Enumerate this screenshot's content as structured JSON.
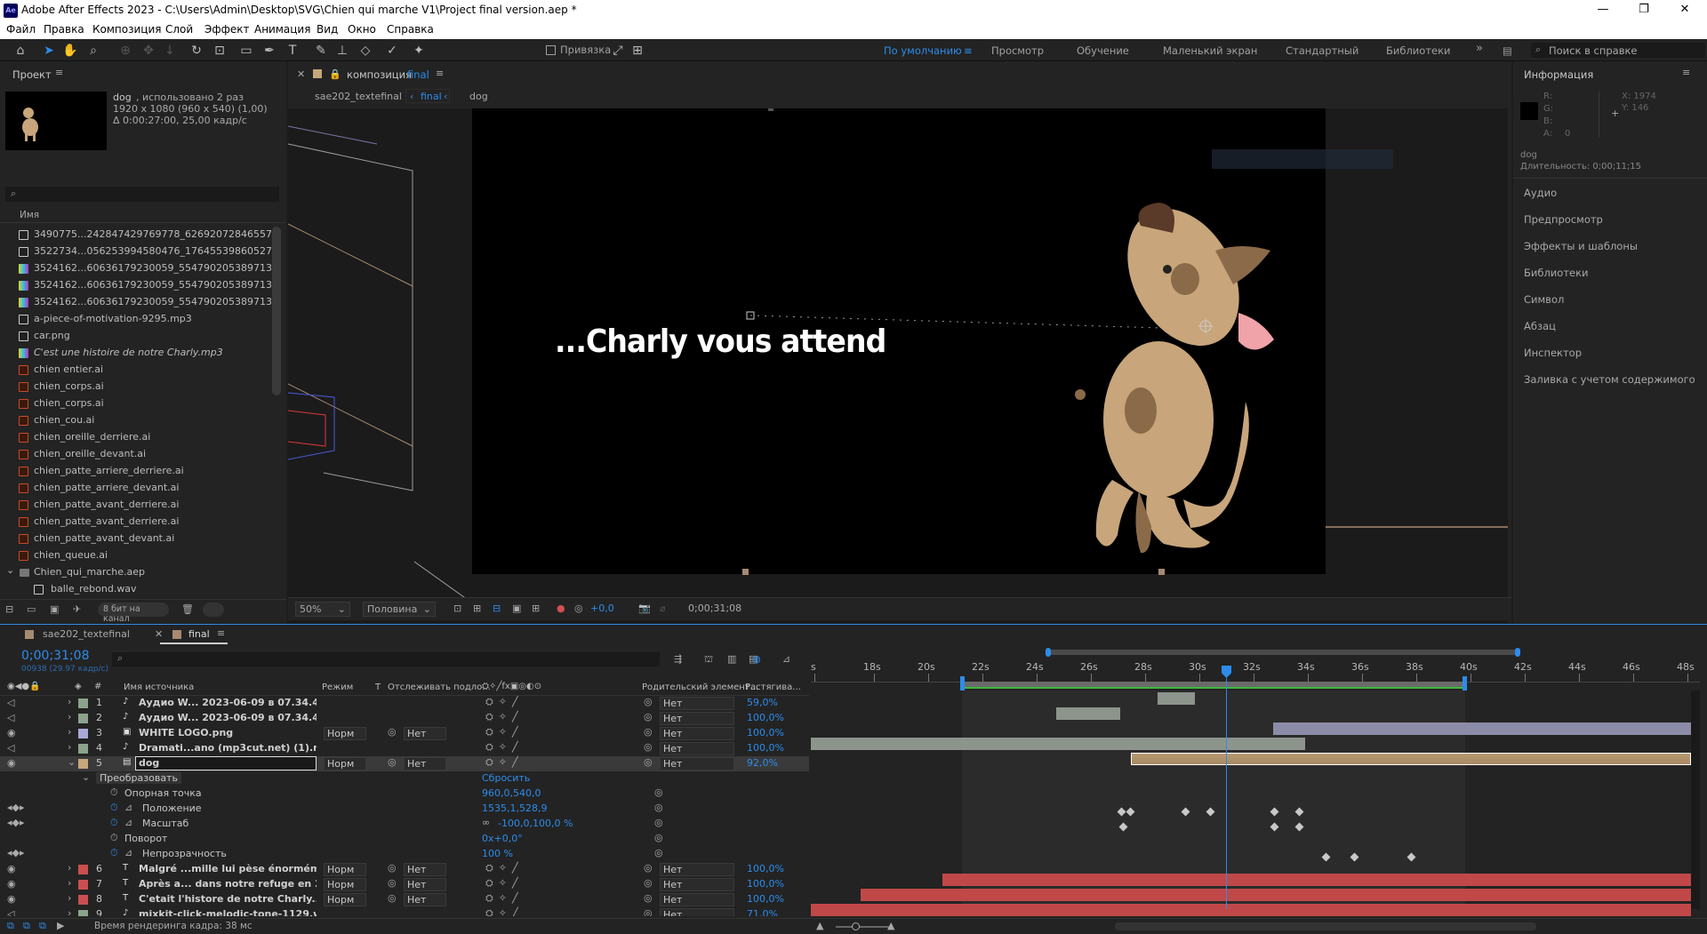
{
  "window": {
    "title": "Adobe After Effects 2023 - C:\\Users\\Admin\\Desktop\\SVG\\Chien qui marche V1\\Project final version.aep *",
    "app_icon": "Ae"
  },
  "menu": [
    "Файл",
    "Правка",
    "Композиция",
    "Слой",
    "Эффект",
    "Анимация",
    "Вид",
    "Окно",
    "Справка"
  ],
  "toolbar": {
    "snap_label": "Привязка",
    "workspaces": [
      "По умолчанию",
      "Просмотр",
      "Обучение",
      "Маленький экран",
      "Стандартный",
      "Библиотеки"
    ],
    "search_placeholder": "Поиск в справке"
  },
  "project": {
    "title": "Проект",
    "item_name": "dog",
    "item_usage": ", использовано 2 раз",
    "item_dims": "1920 x 1080  (960 x 540) (1,00)",
    "item_duration": "Δ 0:00:27:00, 25,00 кадр/с",
    "col_name": "Имя",
    "bpc": "8 бит на канал",
    "files": [
      {
        "name": "3490775...242847429769778_626920728465570929_n",
        "type": "img"
      },
      {
        "name": "3522734...056253994580476_1764553986052705648_",
        "type": "img"
      },
      {
        "name": "3524162...60636179230059_5547902053897132574_n",
        "type": "comp"
      },
      {
        "name": "3524162...60636179230059_5547902053897132574_n",
        "type": "comp"
      },
      {
        "name": "3524162...60636179230059_5547902053897132574_n",
        "type": "comp"
      },
      {
        "name": "a-piece-of-motivation-9295.mp3",
        "type": "img"
      },
      {
        "name": "car.png",
        "type": "img"
      },
      {
        "name": "C'est une histoire de notre Charly.mp3",
        "type": "comp"
      },
      {
        "name": "chien entier.ai",
        "type": "ai"
      },
      {
        "name": "chien_corps.ai",
        "type": "ai"
      },
      {
        "name": "chien_corps.ai",
        "type": "ai"
      },
      {
        "name": "chien_cou.ai",
        "type": "ai"
      },
      {
        "name": "chien_oreille_derriere.ai",
        "type": "ai"
      },
      {
        "name": "chien_oreille_devant.ai",
        "type": "ai"
      },
      {
        "name": "chien_patte_arriere_derriere.ai",
        "type": "ai"
      },
      {
        "name": "chien_patte_arriere_devant.ai",
        "type": "ai"
      },
      {
        "name": "chien_patte_avant_derriere.ai",
        "type": "ai"
      },
      {
        "name": "chien_patte_avant_derriere.ai",
        "type": "ai"
      },
      {
        "name": "chien_patte_avant_devant.ai",
        "type": "ai"
      },
      {
        "name": "chien_queue.ai",
        "type": "ai"
      },
      {
        "name": "Chien_qui_marche.aep",
        "type": "folder"
      },
      {
        "name": "balle_rebond.wav",
        "type": "img"
      }
    ]
  },
  "composition": {
    "tab_prefix": "композиция",
    "tab_name": "final",
    "breadcrumbs": [
      "sae202_textefinal",
      "final",
      "dog"
    ],
    "overlay_text": "...Charly vous attend",
    "zoom": "50%",
    "resolution": "Половина",
    "exposure": "+0,0",
    "timecode": "0;00;31;08"
  },
  "info": {
    "title": "Информация",
    "r": "R:",
    "g": "G:",
    "b": "B:",
    "a": "A:",
    "a_val": "0",
    "x": "X:  1974",
    "y": "Y:  146",
    "layer": "dog",
    "duration": "Длительность: 0;00;11;15",
    "panels": [
      "Аудио",
      "Предпросмотр",
      "Эффекты и шаблоны",
      "Библиотеки",
      "Символ",
      "Абзац",
      "Инспектор",
      "Заливка с учетом содержимого"
    ]
  },
  "timeline": {
    "tabs": [
      "sae202_textefinal",
      "final"
    ],
    "timecode": "0;00;31;08",
    "fps": "00938 (29.97 кадр/с)",
    "headers": {
      "source": "Имя источника",
      "mode": "Режим",
      "t": "T",
      "track": "Отслеживать подло...",
      "parent": "Родительский элемент...",
      "stretch": "Растягива..."
    },
    "ruler": [
      "s",
      "18s",
      "20s",
      "22s",
      "24s",
      "26s",
      "28s",
      "30s",
      "32s",
      "34s",
      "36s",
      "38s",
      "40s",
      "42s",
      "44s",
      "46s",
      "48s"
    ],
    "layers": [
      {
        "num": "1",
        "name": "Аудио W... 2023-06-09 в 07.34.46.mp3",
        "mode": "",
        "track": "",
        "parent": "Нет",
        "stretch": "59,0%",
        "color": "#8aa38a",
        "icon": "♪"
      },
      {
        "num": "2",
        "name": "Аудио W... 2023-06-09 в 07.34.46.mp3",
        "mode": "",
        "track": "",
        "parent": "Нет",
        "stretch": "100,0%",
        "color": "#8aa38a",
        "icon": "♪"
      },
      {
        "num": "3",
        "name": "WHITE LOGO.png",
        "mode": "Норм",
        "track": "Нет",
        "parent": "Нет",
        "stretch": "100,0%",
        "color": "#a8a8d8",
        "icon": "▣"
      },
      {
        "num": "4",
        "name": "Dramati...ano (mp3cut.net) (1).mp3",
        "mode": "",
        "track": "",
        "parent": "Нет",
        "stretch": "100,0%",
        "color": "#8aa38a",
        "icon": "♪"
      },
      {
        "num": "5",
        "name": "dog",
        "mode": "Норм",
        "track": "Нет",
        "parent": "Нет",
        "stretch": "92,0%",
        "color": "#c5a77a",
        "icon": "▤"
      }
    ],
    "transform": {
      "label": "Преобразовать",
      "reset": "Сбросить",
      "props": [
        {
          "name": "Опорная точка",
          "value": "960,0,540,0"
        },
        {
          "name": "Положение",
          "value": "1535,1,528,9"
        },
        {
          "name": "Масштаб",
          "value": "-100,0,100,0 %"
        },
        {
          "name": "Поворот",
          "value": "0x+0,0°"
        },
        {
          "name": "Непрозрачность",
          "value": "100 %"
        }
      ]
    },
    "layers2": [
      {
        "num": "6",
        "name": "Malgré ...mille lui pèse énormément.",
        "mode": "Норм",
        "track": "Нет",
        "parent": "Нет",
        "stretch": "100,0%",
        "color": "#c94f4f",
        "icon": "T"
      },
      {
        "num": "7",
        "name": "Après a... dans notre refuge en 2021.",
        "mode": "Норм",
        "track": "Нет",
        "parent": "Нет",
        "stretch": "100,0%",
        "color": "#c94f4f",
        "icon": "T"
      },
      {
        "num": "8",
        "name": "C'etait l'histore de notre Charly...",
        "mode": "Норм",
        "track": "Нет",
        "parent": "Нет",
        "stretch": "100,0%",
        "color": "#c94f4f",
        "icon": "T"
      },
      {
        "num": "9",
        "name": "mixkit-click-melodic-tone-1129.wav",
        "mode": "",
        "track": "",
        "parent": "Нет",
        "stretch": "71,0%",
        "color": "#8aa38a",
        "icon": "♪"
      }
    ],
    "render_time": "Время рендеринга кадра: 38 мс"
  }
}
